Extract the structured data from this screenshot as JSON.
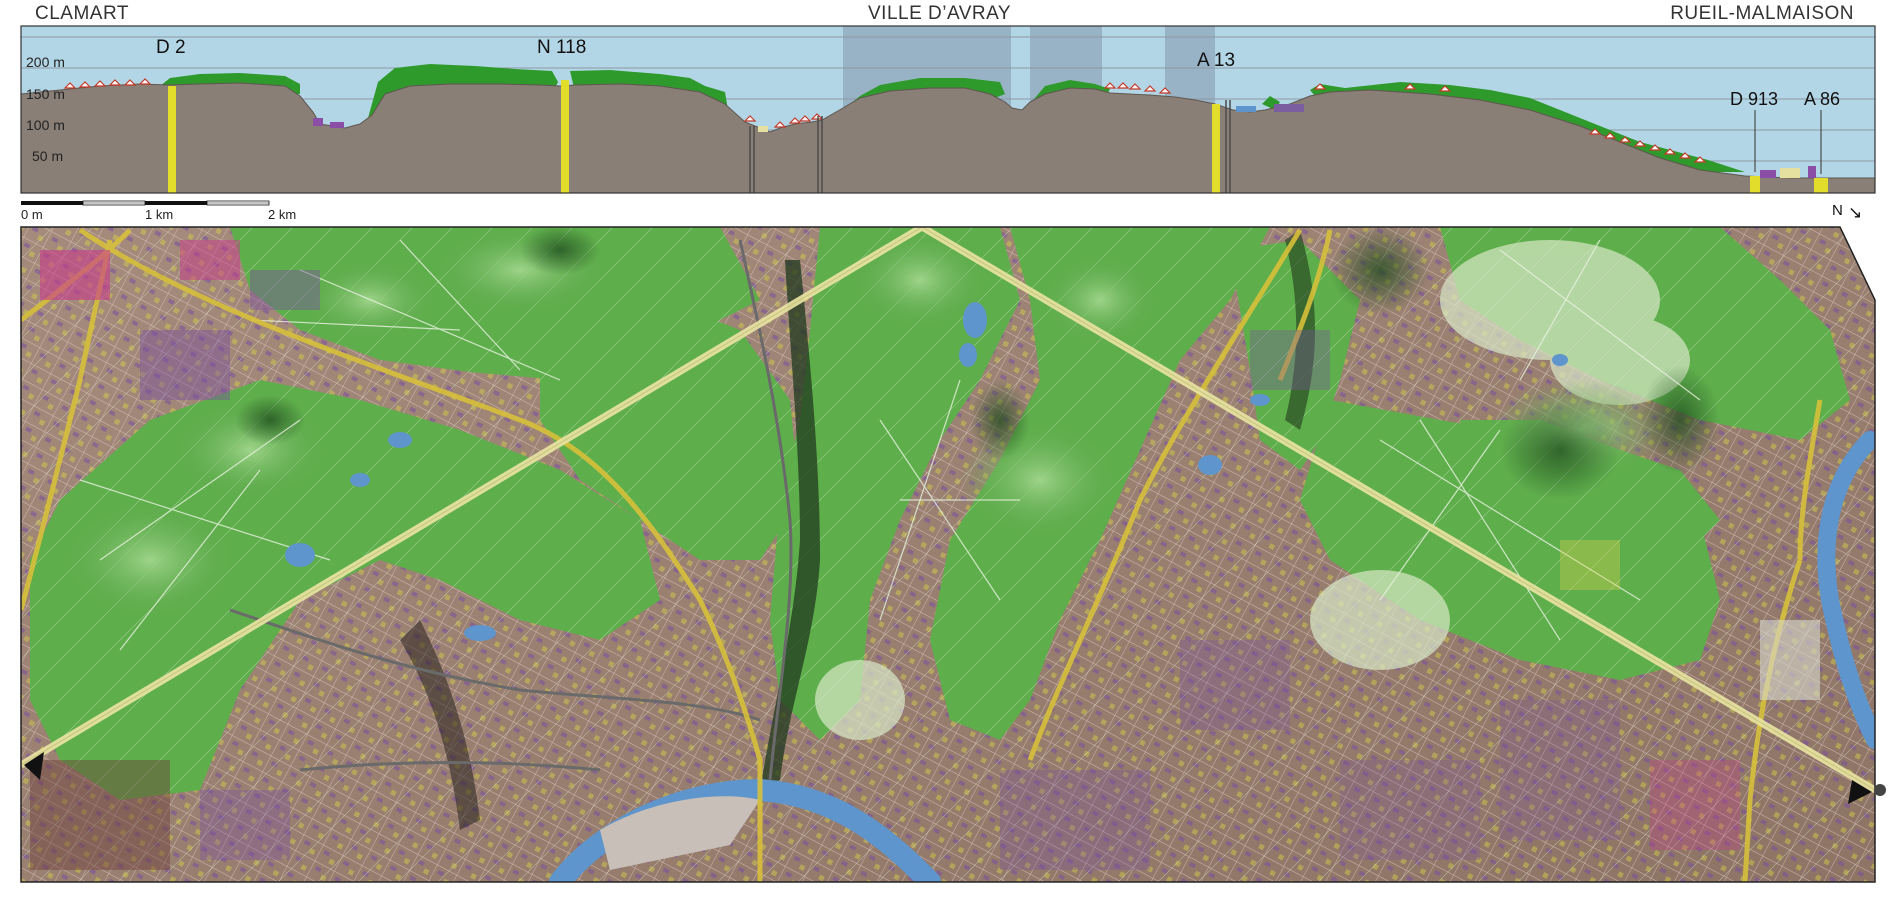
{
  "places": {
    "left": "CLAMART",
    "center": "VILLE D’AVRAY",
    "right": "RUEIL-MALMAISON"
  },
  "profile": {
    "elevation_ticks": [
      "200 m",
      "150 m",
      "100 m",
      "50 m"
    ],
    "roads": [
      "D 2",
      "N 118",
      "A 13",
      "D 913",
      "A 86"
    ]
  },
  "scale": {
    "zero": "0 m",
    "one": "1 km",
    "two": "2 km"
  },
  "north": {
    "label": "N",
    "arrow": "↘"
  },
  "colors": {
    "sky": "#b3d6e6",
    "ground": "#8a7f76",
    "forest": "#2f9a2c",
    "road_marker": "#e2dc2a",
    "water": "#5e95cc",
    "map_forest": "#5fae4c",
    "urban": "#9a8373"
  }
}
